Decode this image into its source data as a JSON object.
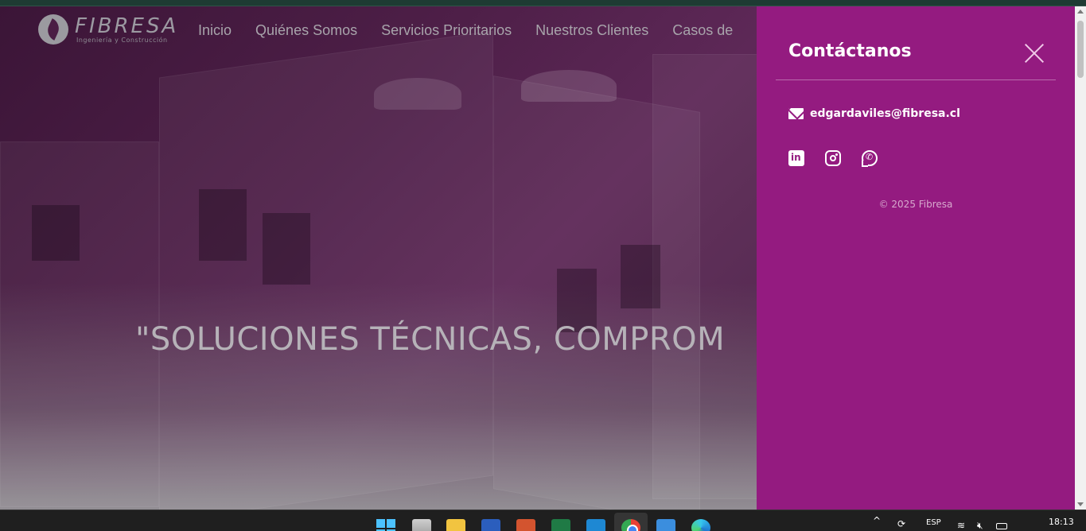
{
  "site": {
    "logo": {
      "name": "FIBRESA",
      "tagline": "Ingeniería y Construcción"
    },
    "nav": [
      "Inicio",
      "Quiénes Somos",
      "Servicios Prioritarios",
      "Nuestros Clientes",
      "Casos de"
    ],
    "hero_quote": "\"SOLUCIONES TÉCNICAS, COMPROM"
  },
  "contact_panel": {
    "title": "Contáctanos",
    "email": "edgardaviles@fibresa.cl",
    "social": [
      "linkedin-icon",
      "instagram-icon",
      "whatsapp-icon"
    ],
    "copyright": "© 2025 Fibresa",
    "background_color": "#941b80"
  },
  "taskbar": {
    "apps": [
      "start",
      "task-view",
      "file-explorer",
      "word",
      "powerpoint",
      "excel",
      "vscode",
      "chrome",
      "photos",
      "edge"
    ],
    "language": "ESP",
    "time": "18:13"
  }
}
